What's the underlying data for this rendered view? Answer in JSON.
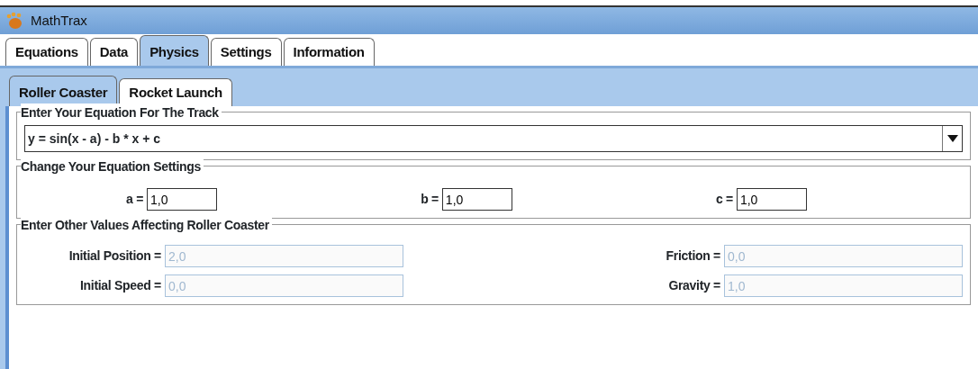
{
  "window": {
    "title": "MathTrax"
  },
  "tabs": [
    {
      "label": "Equations",
      "selected": false
    },
    {
      "label": "Data",
      "selected": false
    },
    {
      "label": "Physics",
      "selected": true
    },
    {
      "label": "Settings",
      "selected": false
    },
    {
      "label": "Information",
      "selected": false
    }
  ],
  "subtabs": [
    {
      "label": "Roller Coaster",
      "selected": true
    },
    {
      "label": "Rocket Launch",
      "selected": false
    }
  ],
  "track_section": {
    "title": "Enter Your Equation For The Track",
    "equation": "y = sin(x - a) - b * x + c"
  },
  "settings_section": {
    "title": "Change Your Equation Settings",
    "fields": [
      {
        "label": "a =",
        "value": "1,0"
      },
      {
        "label": "b =",
        "value": "1,0"
      },
      {
        "label": "c =",
        "value": "1,0"
      }
    ]
  },
  "other_section": {
    "title": "Enter Other Values Affecting Roller Coaster",
    "fields": [
      {
        "label": "Initial Position =",
        "value": "2,0",
        "disabled": true
      },
      {
        "label": "Friction =",
        "value": "0,0",
        "disabled": true
      },
      {
        "label": "Initial Speed =",
        "value": "0,0",
        "disabled": true
      },
      {
        "label": "Gravity =",
        "value": "1,0",
        "disabled": true
      }
    ]
  }
}
